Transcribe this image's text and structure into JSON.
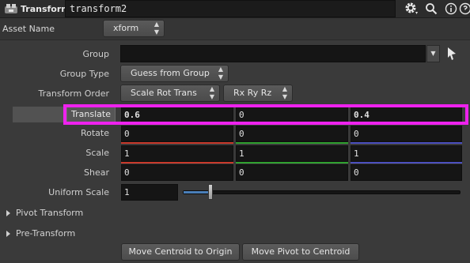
{
  "header": {
    "node_type": "Transform",
    "node_name": "transform2",
    "icons": [
      "transform-node-icon",
      "gear-icon",
      "search-icon",
      "info-icon",
      "help-icon"
    ]
  },
  "asset": {
    "label": "Asset Name",
    "value": "xform"
  },
  "group": {
    "label": "Group",
    "value": ""
  },
  "group_type": {
    "label": "Group Type",
    "value": "Guess from Group"
  },
  "transform_order": {
    "label": "Transform Order",
    "order_value": "Scale Rot Trans",
    "rot_value": "Rx Ry Rz"
  },
  "translate": {
    "label": "Translate",
    "x": "0.6",
    "y": "0",
    "z": "0.4"
  },
  "rotate": {
    "label": "Rotate",
    "x": "0",
    "y": "0",
    "z": "0"
  },
  "scale": {
    "label": "Scale",
    "x": "1",
    "y": "1",
    "z": "1"
  },
  "shear": {
    "label": "Shear",
    "x": "0",
    "y": "0",
    "z": "0"
  },
  "uniform_scale": {
    "label": "Uniform Scale",
    "value": "1",
    "slider_fraction": 0.1
  },
  "sections": {
    "pivot": "Pivot Transform",
    "pre": "Pre-Transform"
  },
  "buttons": {
    "centroid_to_origin": "Move Centroid to Origin",
    "pivot_to_centroid": "Move Pivot to Centroid"
  },
  "colors": {
    "x_axis": "#c8392b",
    "y_axis": "#2fa12f",
    "z_axis": "#4b4fbf",
    "highlight": "#ee22ee",
    "slider": "#4a7fb8"
  }
}
